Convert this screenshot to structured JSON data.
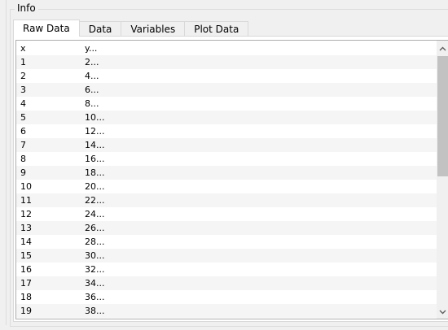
{
  "group": {
    "title": "Info"
  },
  "tabs": [
    {
      "label": "Raw Data",
      "active": true
    },
    {
      "label": "Data",
      "active": false
    },
    {
      "label": "Variables",
      "active": false
    },
    {
      "label": "Plot Data",
      "active": false
    }
  ],
  "table": {
    "rows": [
      {
        "x": "x",
        "y": "y..."
      },
      {
        "x": "1",
        "y": "2..."
      },
      {
        "x": "2",
        "y": "4..."
      },
      {
        "x": "3",
        "y": "6..."
      },
      {
        "x": "4",
        "y": "8..."
      },
      {
        "x": "5",
        "y": "10..."
      },
      {
        "x": "6",
        "y": "12..."
      },
      {
        "x": "7",
        "y": "14..."
      },
      {
        "x": "8",
        "y": "16..."
      },
      {
        "x": "9",
        "y": "18..."
      },
      {
        "x": "10",
        "y": "20..."
      },
      {
        "x": "11",
        "y": "22..."
      },
      {
        "x": "12",
        "y": "24..."
      },
      {
        "x": "13",
        "y": "26..."
      },
      {
        "x": "14",
        "y": "28..."
      },
      {
        "x": "15",
        "y": "30..."
      },
      {
        "x": "16",
        "y": "32..."
      },
      {
        "x": "17",
        "y": "34..."
      },
      {
        "x": "18",
        "y": "36..."
      },
      {
        "x": "19",
        "y": "38..."
      }
    ]
  },
  "icons": {
    "scroll_up": "chevron-up-icon",
    "scroll_down": "chevron-down-icon"
  }
}
